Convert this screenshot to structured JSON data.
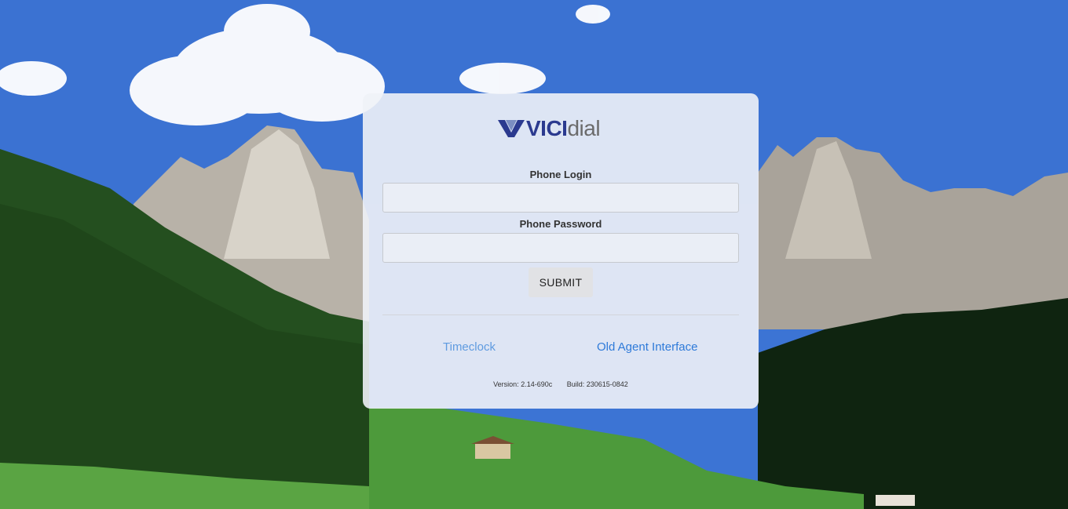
{
  "logo": {
    "brand_bold": "VICI",
    "brand_light": "dial",
    "icon": "vicidial-logo-mark"
  },
  "login_form": {
    "phone_login_label": "Phone Login",
    "phone_login_value": "",
    "phone_password_label": "Phone Password",
    "phone_password_value": "",
    "submit_label": "SUBMIT"
  },
  "links": {
    "timeclock": "Timeclock",
    "old_agent_interface": "Old Agent Interface"
  },
  "footer": {
    "version": "Version: 2.14-690c",
    "build": "Build: 230615-0842"
  },
  "colors": {
    "brand_primary": "#2b3a8f",
    "brand_secondary": "#6b6b6b",
    "link_timeclock": "#5f9be0",
    "link_old_agent": "#2e7ad9",
    "card_bg": "#f0f2f7"
  }
}
